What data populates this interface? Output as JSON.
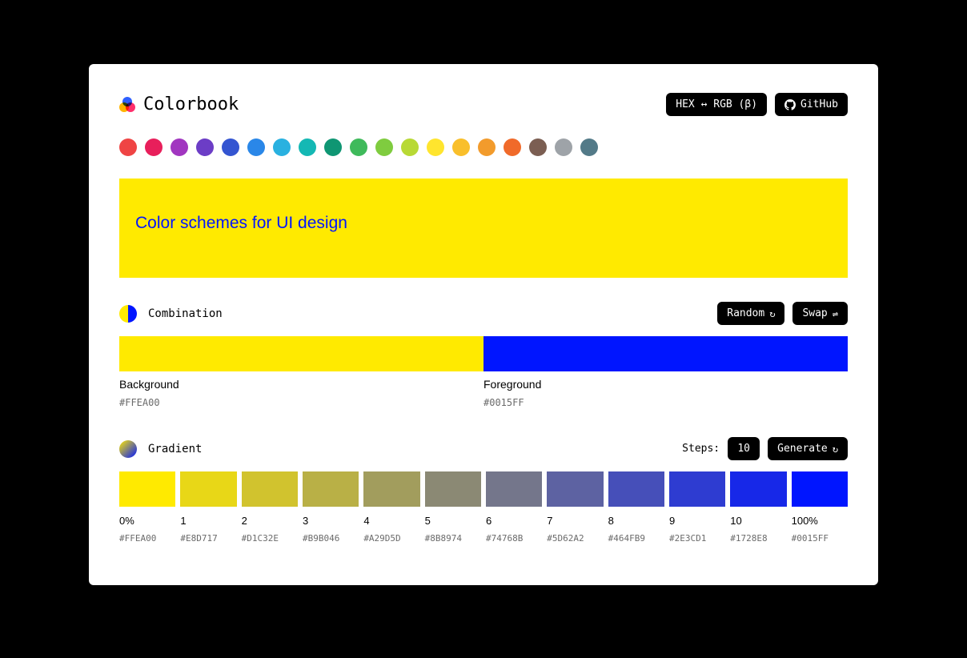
{
  "brand": {
    "name": "Colorbook"
  },
  "header": {
    "hexrgb_label": "HEX ↔ RGB (β)",
    "github_label": "GitHub"
  },
  "palette": [
    "#ef4444",
    "#e81f5b",
    "#a136c0",
    "#6c3dc6",
    "#3455d1",
    "#2a87e8",
    "#29b1e0",
    "#14b8b4",
    "#0f9673",
    "#3fba5b",
    "#7fcc3f",
    "#b8d935",
    "#ffe52e",
    "#f9bf2b",
    "#f29b2c",
    "#f06a2a",
    "#7b5e52",
    "#9ea3a8",
    "#537a88"
  ],
  "hero": {
    "text": "Color schemes for UI design",
    "bg": "#FFEA00",
    "fg": "#0015FF"
  },
  "combination": {
    "title": "Combination",
    "random_label": "Random",
    "swap_label": "Swap",
    "bg_label": "Background",
    "fg_label": "Foreground",
    "bg_hex": "#FFEA00",
    "fg_hex": "#0015FF"
  },
  "gradient": {
    "title": "Gradient",
    "steps_label": "Steps:",
    "steps_value": "10",
    "generate_label": "Generate",
    "steps": [
      {
        "step": "0%",
        "hex": "#FFEA00"
      },
      {
        "step": "1",
        "hex": "#E8D717"
      },
      {
        "step": "2",
        "hex": "#D1C32E"
      },
      {
        "step": "3",
        "hex": "#B9B046"
      },
      {
        "step": "4",
        "hex": "#A29D5D"
      },
      {
        "step": "5",
        "hex": "#8B8974"
      },
      {
        "step": "6",
        "hex": "#74768B"
      },
      {
        "step": "7",
        "hex": "#5D62A2"
      },
      {
        "step": "8",
        "hex": "#464FB9"
      },
      {
        "step": "9",
        "hex": "#2E3CD1"
      },
      {
        "step": "10",
        "hex": "#1728E8"
      },
      {
        "step": "100%",
        "hex": "#0015FF"
      }
    ]
  }
}
